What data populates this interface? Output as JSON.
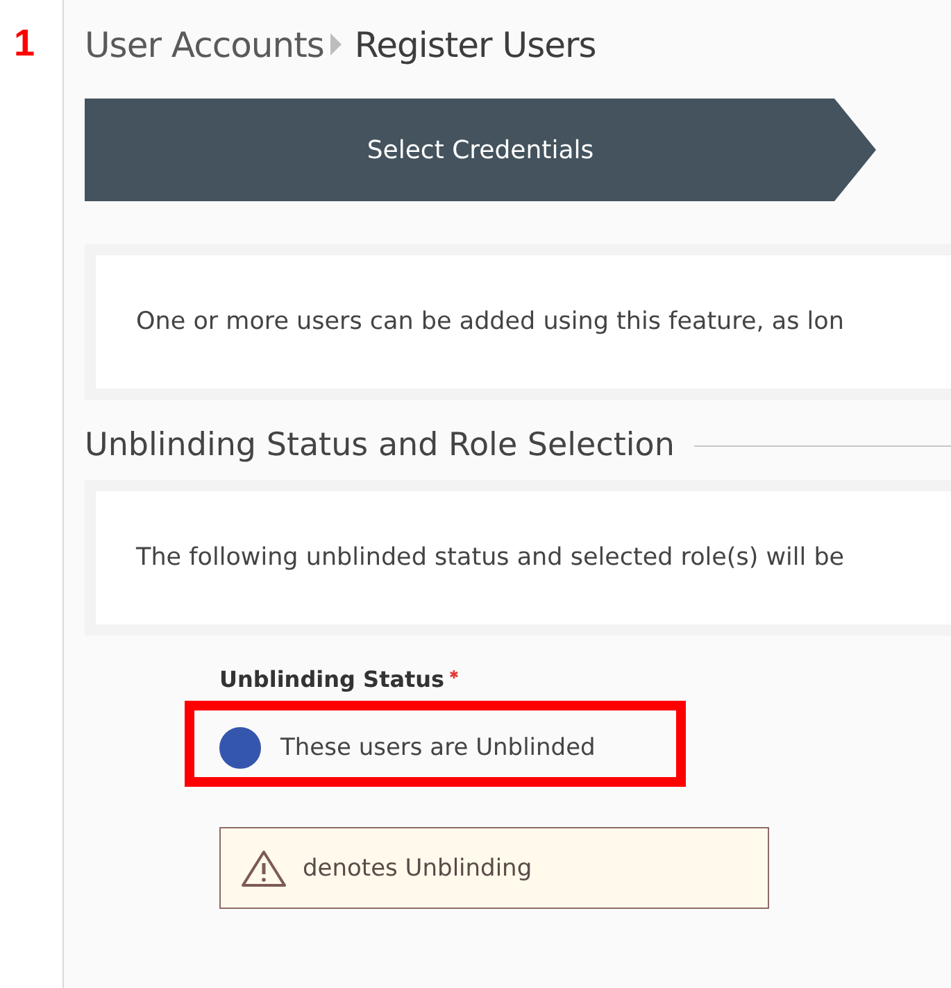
{
  "step_marker": "1",
  "breadcrumb": [
    "User Accounts",
    "Register Users"
  ],
  "wizard_steps": [
    {
      "label": "Select Credentials",
      "selected": true
    }
  ],
  "intro_text": "One or more users can be added using this feature, as lon",
  "section": {
    "heading": "Unblinding Status and Role Selection",
    "text": "The following unblinded status and selected role(s) will be"
  },
  "field": {
    "label": "Unblinding Status",
    "required": true,
    "options": [
      {
        "label": "These users are Unblinded",
        "selected": true,
        "highlighted": true
      }
    ]
  },
  "notice": {
    "text": "denotes Unblinding"
  }
}
